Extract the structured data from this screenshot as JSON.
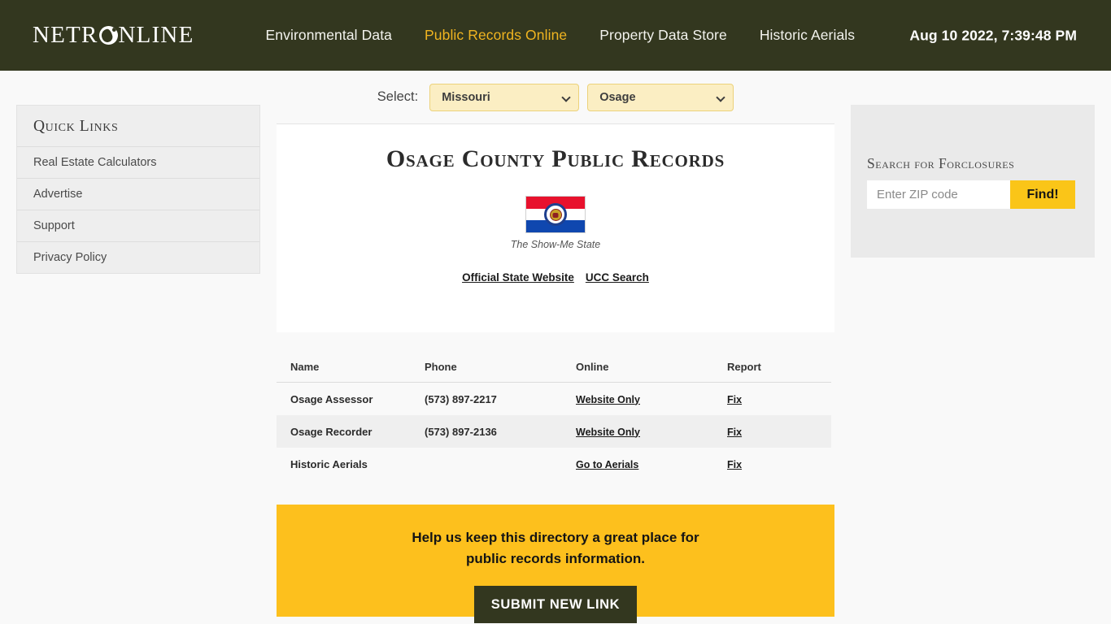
{
  "header": {
    "logo": "NETR NLINE",
    "logo_part1": "NETR",
    "logo_part2": "NLINE",
    "nav": [
      {
        "label": "Environmental Data",
        "active": false
      },
      {
        "label": "Public Records Online",
        "active": true
      },
      {
        "label": "Property Data Store",
        "active": false
      },
      {
        "label": "Historic Aerials",
        "active": false
      }
    ],
    "clock": "Aug 10 2022, 7:39:48 PM",
    "bg_color": "#33371f",
    "accent_color": "#f0b420"
  },
  "sidebar": {
    "title": "Quick Links",
    "items": [
      {
        "label": "Real Estate Calculators"
      },
      {
        "label": "Advertise"
      },
      {
        "label": "Support"
      },
      {
        "label": "Privacy Policy"
      }
    ]
  },
  "selectbar": {
    "label": "Select:",
    "state": "Missouri",
    "county": "Osage"
  },
  "main": {
    "title": "Osage County Public Records",
    "flag_caption": "The Show-Me State",
    "state_links": [
      {
        "label": "Official State Website"
      },
      {
        "label": "UCC Search"
      }
    ],
    "table": {
      "columns": [
        "Name",
        "Phone",
        "Online",
        "Report"
      ],
      "rows": [
        {
          "name": "Osage Assessor",
          "phone": "(573) 897-2217",
          "online": "Website Only",
          "report": "Fix"
        },
        {
          "name": "Osage Recorder",
          "phone": "(573) 897-2136",
          "online": "Website Only",
          "report": "Fix"
        },
        {
          "name": "Historic Aerials",
          "phone": "",
          "online": "Go to Aerials",
          "report": "Fix"
        }
      ]
    },
    "cta": {
      "line1": "Help us keep this directory a great place for",
      "line2": "public records information.",
      "button": "SUBMIT NEW LINK",
      "bg_color": "#fdc01d"
    }
  },
  "rightbar": {
    "title": "Search for Forclosures",
    "zip_placeholder": "Enter ZIP code",
    "zip_value": "",
    "find_button": "Find!"
  }
}
